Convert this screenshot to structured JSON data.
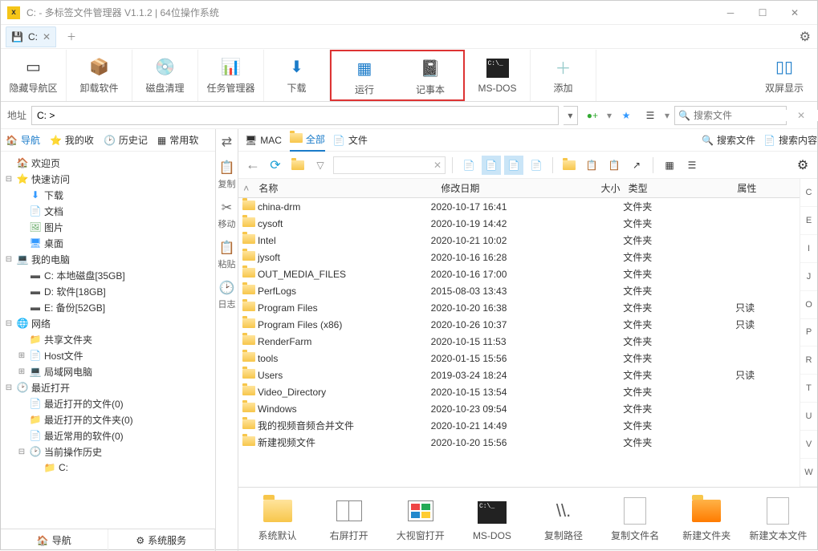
{
  "title": "C: - 多标签文件管理器 V1.1.2  |  64位操作系统",
  "tab": {
    "drive": "C:",
    "icon": "drive-icon"
  },
  "toolbar": [
    {
      "id": "hide-nav",
      "label": "隐藏导航区"
    },
    {
      "id": "uninstall",
      "label": "卸载软件"
    },
    {
      "id": "disk-clean",
      "label": "磁盘清理"
    },
    {
      "id": "task-mgr",
      "label": "任务管理器"
    },
    {
      "id": "download",
      "label": "下载"
    },
    {
      "id": "run",
      "label": "运行"
    },
    {
      "id": "notepad",
      "label": "记事本"
    },
    {
      "id": "msdos",
      "label": "MS-DOS"
    },
    {
      "id": "add",
      "label": "添加"
    },
    {
      "id": "dual",
      "label": "双屏显示"
    }
  ],
  "addr": {
    "label": "地址",
    "value": "C: >"
  },
  "search": {
    "placeholder": "搜索文件"
  },
  "left_tabs": [
    "导航",
    "我的收",
    "历史记",
    "常用软"
  ],
  "tree": [
    {
      "d": 1,
      "exp": "",
      "icon": "🏠",
      "label": "欢迎页",
      "color": "#2a7"
    },
    {
      "d": 1,
      "exp": "⊟",
      "icon": "⭐",
      "label": "快速访问",
      "color": "#39f"
    },
    {
      "d": 2,
      "exp": "",
      "icon": "⬇",
      "label": "下载",
      "color": "#39f"
    },
    {
      "d": 2,
      "exp": "",
      "icon": "📄",
      "label": "文档",
      "color": "#9cf"
    },
    {
      "d": 2,
      "exp": "",
      "icon": "🖼",
      "label": "图片",
      "color": "#6a6"
    },
    {
      "d": 2,
      "exp": "",
      "icon": "🖥",
      "label": "桌面",
      "color": "#39f"
    },
    {
      "d": 1,
      "exp": "⊟",
      "icon": "💻",
      "label": "我的电脑",
      "color": "#39f"
    },
    {
      "d": 2,
      "exp": "",
      "icon": "▬",
      "label": "C: 本地磁盘[35GB]",
      "color": "#555"
    },
    {
      "d": 2,
      "exp": "",
      "icon": "▬",
      "label": "D: 软件[18GB]",
      "color": "#555"
    },
    {
      "d": 2,
      "exp": "",
      "icon": "▬",
      "label": "E: 备份[52GB]",
      "color": "#555"
    },
    {
      "d": 1,
      "exp": "⊟",
      "icon": "🌐",
      "label": "网络",
      "color": "#39f"
    },
    {
      "d": 2,
      "exp": "",
      "icon": "📁",
      "label": "共享文件夹",
      "color": "#f5c04a"
    },
    {
      "d": 2,
      "exp": "⊞",
      "icon": "📄",
      "label": "Host文件",
      "color": "#888"
    },
    {
      "d": 2,
      "exp": "⊞",
      "icon": "💻",
      "label": "局域网电脑",
      "color": "#39f"
    },
    {
      "d": 1,
      "exp": "⊟",
      "icon": "🕑",
      "label": "最近打开",
      "color": "#f90"
    },
    {
      "d": 2,
      "exp": "",
      "icon": "📄",
      "label": "最近打开的文件(0)",
      "color": "#fc6"
    },
    {
      "d": 2,
      "exp": "",
      "icon": "📁",
      "label": "最近打开的文件夹(0)",
      "color": "#f5c04a"
    },
    {
      "d": 2,
      "exp": "",
      "icon": "📄",
      "label": "最近常用的软件(0)",
      "color": "#fc6"
    },
    {
      "d": 2,
      "exp": "⊟",
      "icon": "🕑",
      "label": "当前操作历史",
      "color": "#f90"
    },
    {
      "d": 3,
      "exp": "",
      "icon": "📁",
      "label": "C:",
      "color": "#f5c04a"
    }
  ],
  "left_foot": [
    "导航",
    "系统服务"
  ],
  "gutter": [
    {
      "icon": "⇄",
      "label": ""
    },
    {
      "icon": "📋",
      "label": "复制"
    },
    {
      "icon": "✂",
      "label": "移动"
    },
    {
      "icon": "📋",
      "label": "粘贴"
    },
    {
      "icon": "🕑",
      "label": "日志"
    }
  ],
  "rtabs": [
    {
      "icon": "🖥",
      "label": "MAC"
    },
    {
      "icon": "📁",
      "label": "全部",
      "active": true
    },
    {
      "icon": "📄",
      "label": "文件"
    }
  ],
  "rtabs_right": [
    {
      "icon": "🔍",
      "label": "搜索文件"
    },
    {
      "icon": "📄",
      "label": "搜索内容"
    }
  ],
  "cols": {
    "name": "名称",
    "date": "修改日期",
    "size": "大小",
    "type": "类型",
    "attr": "属性"
  },
  "rows": [
    {
      "name": "china-drm",
      "date": "2020-10-17 16:41",
      "type": "文件夹",
      "attr": ""
    },
    {
      "name": "cysoft",
      "date": "2020-10-19 14:42",
      "type": "文件夹",
      "attr": ""
    },
    {
      "name": "Intel",
      "date": "2020-10-21 10:02",
      "type": "文件夹",
      "attr": ""
    },
    {
      "name": "jysoft",
      "date": "2020-10-16 16:28",
      "type": "文件夹",
      "attr": ""
    },
    {
      "name": "OUT_MEDIA_FILES",
      "date": "2020-10-16 17:00",
      "type": "文件夹",
      "attr": ""
    },
    {
      "name": "PerfLogs",
      "date": "2015-08-03 13:43",
      "type": "文件夹",
      "attr": ""
    },
    {
      "name": "Program Files",
      "date": "2020-10-20 16:38",
      "type": "文件夹",
      "attr": "只读"
    },
    {
      "name": "Program Files (x86)",
      "date": "2020-10-26 10:37",
      "type": "文件夹",
      "attr": "只读"
    },
    {
      "name": "RenderFarm",
      "date": "2020-10-15 11:53",
      "type": "文件夹",
      "attr": ""
    },
    {
      "name": "tools",
      "date": "2020-01-15 15:56",
      "type": "文件夹",
      "attr": ""
    },
    {
      "name": "Users",
      "date": "2019-03-24 18:24",
      "type": "文件夹",
      "attr": "只读"
    },
    {
      "name": "Video_Directory",
      "date": "2020-10-15 13:54",
      "type": "文件夹",
      "attr": ""
    },
    {
      "name": "Windows",
      "date": "2020-10-23 09:54",
      "type": "文件夹",
      "attr": ""
    },
    {
      "name": "我的视频音频合并文件",
      "date": "2020-10-21 14:49",
      "type": "文件夹",
      "attr": ""
    },
    {
      "name": "新建视频文件",
      "date": "2020-10-20 15:56",
      "type": "文件夹",
      "attr": ""
    }
  ],
  "alpha": [
    "C",
    "E",
    "I",
    "J",
    "O",
    "P",
    "R",
    "T",
    "U",
    "V",
    "W"
  ],
  "bottom": [
    {
      "id": "sys-default",
      "label": "系统默认"
    },
    {
      "id": "right-open",
      "label": "右屏打开"
    },
    {
      "id": "big-open",
      "label": "大视窗打开"
    },
    {
      "id": "msdos2",
      "label": "MS-DOS"
    },
    {
      "id": "copy-path",
      "label": "复制路径"
    },
    {
      "id": "copy-name",
      "label": "复制文件名"
    },
    {
      "id": "new-folder",
      "label": "新建文件夹"
    },
    {
      "id": "new-text",
      "label": "新建文本文件"
    }
  ]
}
